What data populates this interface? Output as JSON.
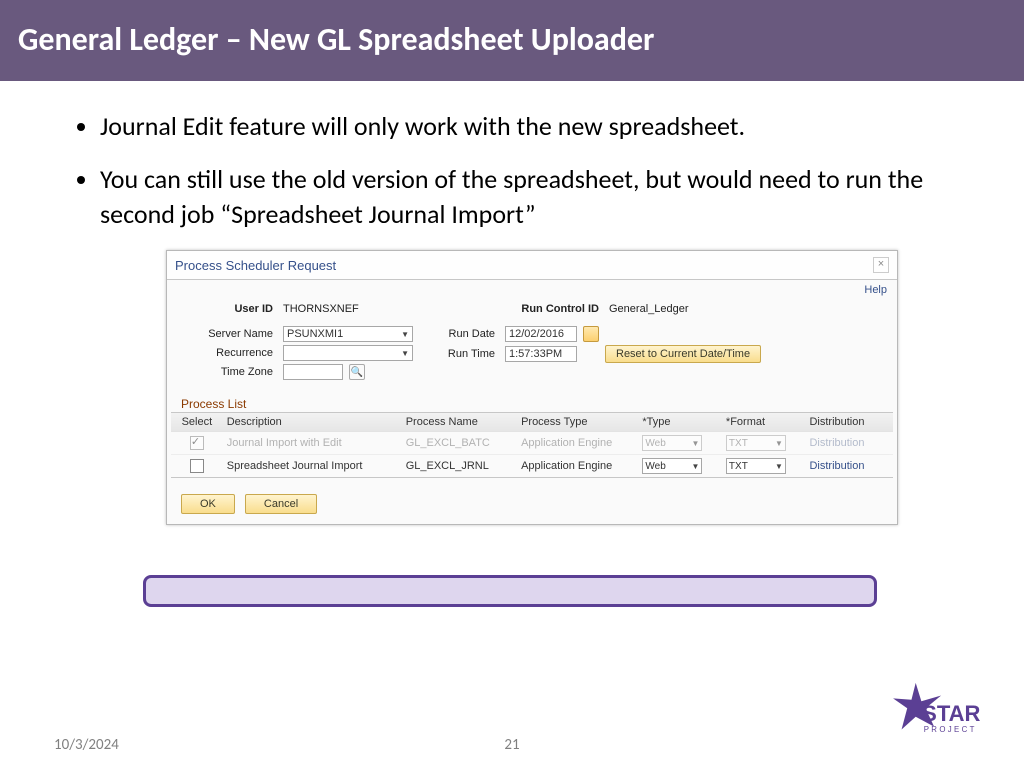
{
  "slide": {
    "title": "General Ledger – New GL Spreadsheet Uploader",
    "bullets": [
      "Journal Edit feature will only work with the new spreadsheet.",
      "You can still use the old version of the spreadsheet, but would need to run the second job “Spreadsheet Journal Import”"
    ]
  },
  "scheduler": {
    "dialog_title": "Process Scheduler Request",
    "help": "Help",
    "user_id_label": "User ID",
    "user_id": "THORNSXNEF",
    "run_control_id_label": "Run Control ID",
    "run_control_id": "General_Ledger",
    "server_name_label": "Server Name",
    "server_name": "PSUNXMI1",
    "recurrence_label": "Recurrence",
    "recurrence": "",
    "time_zone_label": "Time Zone",
    "time_zone": "",
    "run_date_label": "Run Date",
    "run_date": "12/02/2016",
    "run_time_label": "Run Time",
    "run_time": "1:57:33PM",
    "reset_label": "Reset to Current Date/Time",
    "process_list_header": "Process List",
    "columns": {
      "select": "Select",
      "description": "Description",
      "process_name": "Process Name",
      "process_type": "Process Type",
      "type": "*Type",
      "format": "*Format",
      "distribution": "Distribution"
    },
    "rows": [
      {
        "selected": true,
        "description": "Journal Import with Edit",
        "process_name": "GL_EXCL_BATC",
        "process_type": "Application Engine",
        "type": "Web",
        "format": "TXT",
        "distribution": "Distribution"
      },
      {
        "selected": false,
        "description": "Spreadsheet Journal Import",
        "process_name": "GL_EXCL_JRNL",
        "process_type": "Application Engine",
        "type": "Web",
        "format": "TXT",
        "distribution": "Distribution"
      }
    ],
    "ok": "OK",
    "cancel": "Cancel"
  },
  "footer": {
    "date": "10/3/2024",
    "page": "21",
    "logo_main": "STAR",
    "logo_sub": "PROJECT"
  }
}
